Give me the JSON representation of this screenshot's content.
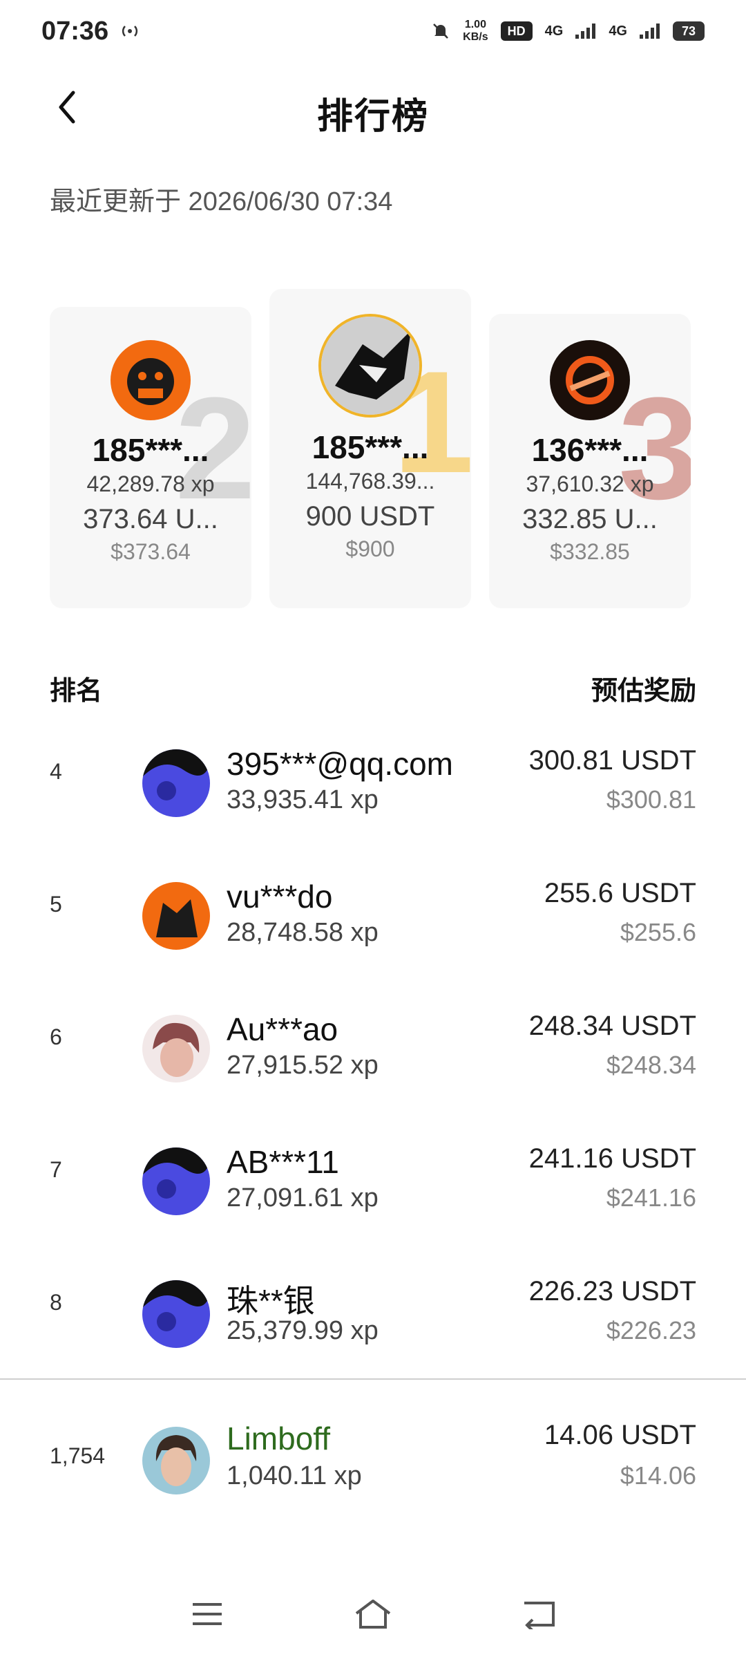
{
  "status_bar": {
    "time": "07:36",
    "net_speed_top": "1.00",
    "net_speed_bottom": "KB/s",
    "hd": "HD",
    "net1": "4G",
    "net2": "4G",
    "battery": "73"
  },
  "header": {
    "title": "排行榜"
  },
  "updated_text": "最近更新于 2026/06/30 07:34",
  "podium": [
    {
      "rank": "2",
      "name": "185***...",
      "xp": "42,289.78 xp",
      "reward": "373.64 U...",
      "usd": "$373.64",
      "accent": "#d8d8d8"
    },
    {
      "rank": "1",
      "name": "185***...",
      "xp": "144,768.39...",
      "reward": "900 USDT",
      "usd": "$900",
      "accent": "#f7d78a"
    },
    {
      "rank": "3",
      "name": "136***...",
      "xp": "37,610.32 xp",
      "reward": "332.85 U...",
      "usd": "$332.85",
      "accent": "#d9a6a0"
    }
  ],
  "list_header": {
    "rank": "排名",
    "reward": "预估奖励"
  },
  "rows": [
    {
      "rank": "4",
      "name": "395***@qq.com",
      "xp": "33,935.41 xp",
      "reward": "300.81 USDT",
      "usd": "$300.81"
    },
    {
      "rank": "5",
      "name": "vu***do",
      "xp": "28,748.58 xp",
      "reward": "255.6 USDT",
      "usd": "$255.6"
    },
    {
      "rank": "6",
      "name": "Au***ao",
      "xp": "27,915.52 xp",
      "reward": "248.34 USDT",
      "usd": "$248.34"
    },
    {
      "rank": "7",
      "name": "AB***11",
      "xp": "27,091.61 xp",
      "reward": "241.16 USDT",
      "usd": "$241.16"
    },
    {
      "rank": "8",
      "name": "珠**银",
      "xp": "25,379.99 xp",
      "reward": "226.23 USDT",
      "usd": "$226.23"
    }
  ],
  "me": {
    "rank": "1,754",
    "name": "Limboff",
    "xp": "1,040.11 xp",
    "reward": "14.06 USDT",
    "usd": "$14.06"
  },
  "icons": {
    "back": "chevron-left-icon",
    "menu": "menu-icon",
    "home": "home-icon",
    "return": "return-icon"
  }
}
